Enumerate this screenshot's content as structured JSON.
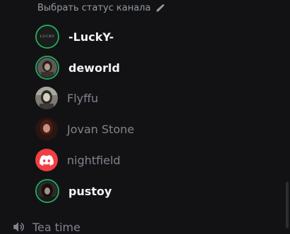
{
  "status": {
    "placeholder": "Выбрать статус канала",
    "edit_icon": "pencil-icon"
  },
  "members": [
    {
      "name": "-LuckY-",
      "state": "active",
      "speaking": true,
      "avatar": "lucky-logo",
      "avatar_text": "LUCKY"
    },
    {
      "name": "deworld",
      "state": "active",
      "speaking": true,
      "avatar": "photo"
    },
    {
      "name": "Flyffu",
      "state": "idle",
      "speaking": false,
      "avatar": "photo"
    },
    {
      "name": "Jovan Stone",
      "state": "idle",
      "speaking": false,
      "avatar": "photo"
    },
    {
      "name": "nightfield",
      "state": "idle",
      "speaking": false,
      "avatar": "discord-default"
    },
    {
      "name": "pustoy",
      "state": "active",
      "speaking": true,
      "avatar": "photo"
    }
  ],
  "next_channel": {
    "icon": "speaker-icon",
    "label": "Tea time"
  },
  "colors": {
    "background": "#121214",
    "speaking_ring": "#23a55a",
    "active_name": "#f2f3f5",
    "idle_name": "#80848e",
    "discord_red": "#f23f43"
  }
}
